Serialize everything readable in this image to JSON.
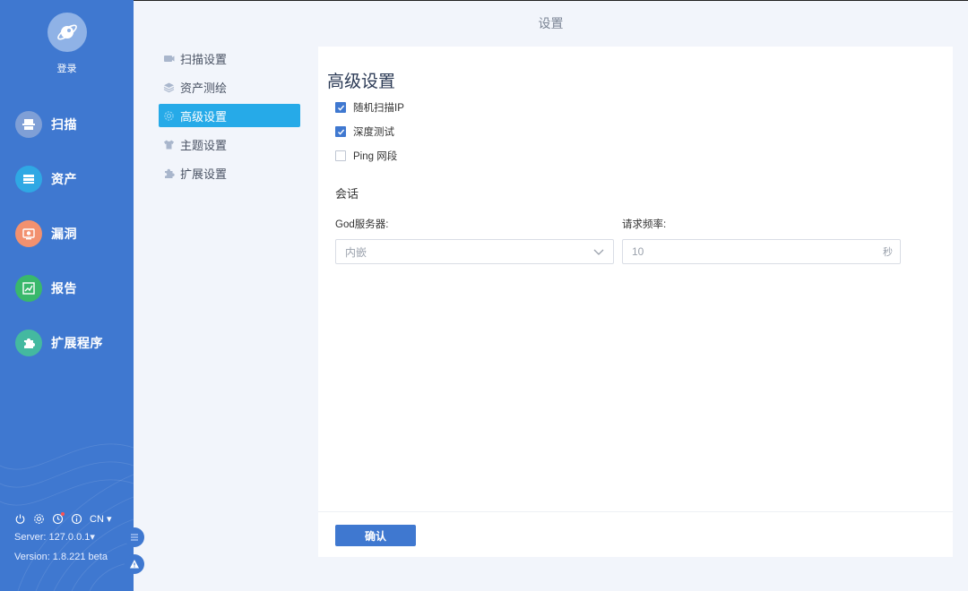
{
  "app": {
    "page_title": "设置",
    "login_label": "登录"
  },
  "nav": {
    "items": [
      {
        "label": "扫描",
        "icon": "scan-icon",
        "color": "#7f9fd6"
      },
      {
        "label": "资产",
        "icon": "asset-icon",
        "color": "#2fa8e4"
      },
      {
        "label": "漏洞",
        "icon": "vuln-icon",
        "color": "#f2916f"
      },
      {
        "label": "报告",
        "icon": "report-icon",
        "color": "#39b86b"
      },
      {
        "label": "扩展程序",
        "icon": "extension-icon",
        "color": "#44b9a0"
      }
    ]
  },
  "footer": {
    "language": "CN",
    "server": "Server: 127.0.0.1",
    "version": "Version: 1.8.221 beta"
  },
  "settings_menu": {
    "items": [
      {
        "label": "扫描设置",
        "icon": "scan-settings-icon"
      },
      {
        "label": "资产测绘",
        "icon": "layers-icon"
      },
      {
        "label": "高级设置",
        "icon": "gear-icon",
        "active": true
      },
      {
        "label": "主题设置",
        "icon": "shirt-icon"
      },
      {
        "label": "扩展设置",
        "icon": "puzzle-icon"
      }
    ]
  },
  "advanced": {
    "title": "高级设置",
    "options": [
      {
        "label": "随机扫描IP",
        "checked": true
      },
      {
        "label": "深度测试",
        "checked": true
      },
      {
        "label": "Ping 网段",
        "checked": false
      }
    ],
    "session_title": "会话",
    "god_server_label": "God服务器:",
    "god_server_value": "内嵌",
    "rate_label": "请求频率:",
    "rate_value": "10",
    "rate_unit": "秒",
    "confirm_label": "确认"
  },
  "colors": {
    "sidebar": "#3f78d0",
    "accent": "#26aae8",
    "button": "#3f78d0"
  }
}
